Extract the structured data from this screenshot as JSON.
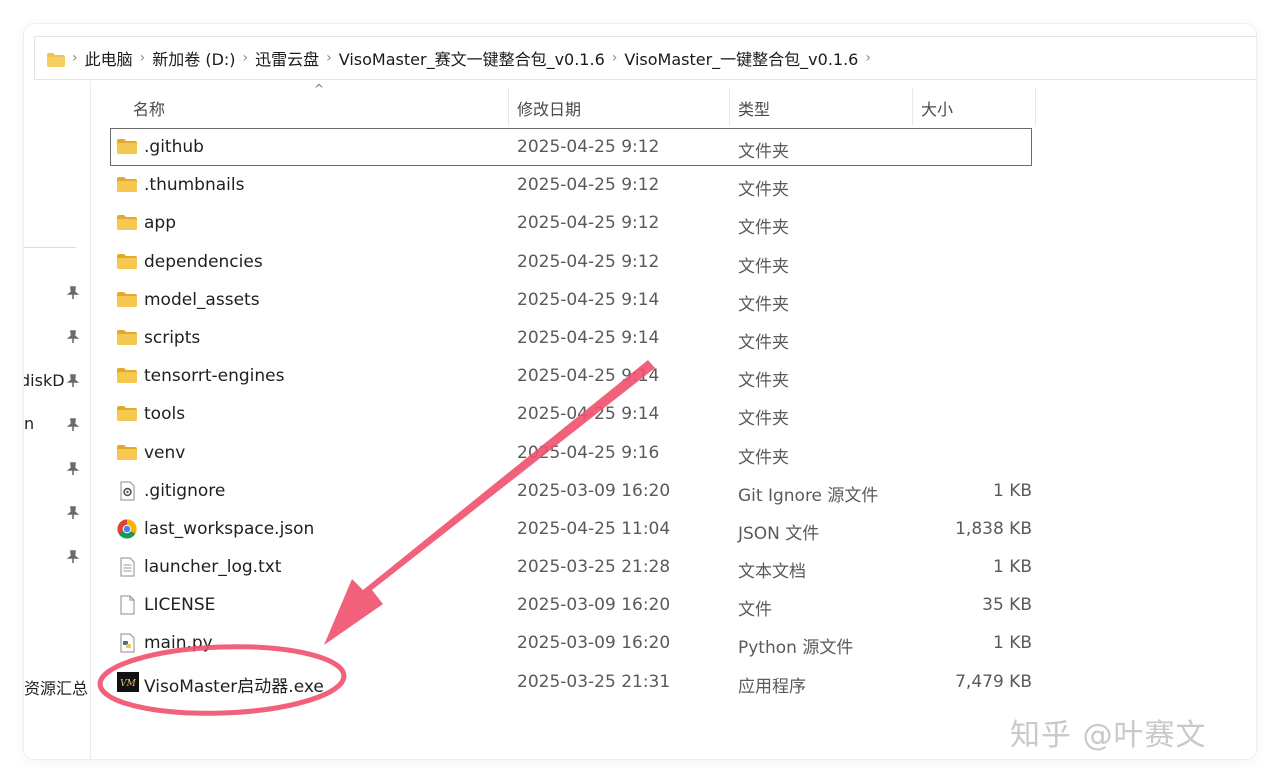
{
  "address": {
    "crumbs": [
      "此电脑",
      "新加卷 (D:)",
      "迅雷云盘",
      "VisoMaster_赛文一键整合包_v0.1.6",
      "VisoMaster_一键整合包_v0.1.6"
    ]
  },
  "nav": {
    "items": [
      {
        "label": "diskD"
      },
      {
        "label": "n"
      },
      {
        "label": "资源汇总"
      }
    ]
  },
  "columns": {
    "name": "名称",
    "date": "修改日期",
    "type": "类型",
    "size": "大小"
  },
  "files": [
    {
      "name": ".github",
      "date": "2025-04-25 9:12",
      "type": "文件夹",
      "size": "",
      "icon": "folder-icon"
    },
    {
      "name": ".thumbnails",
      "date": "2025-04-25 9:12",
      "type": "文件夹",
      "size": "",
      "icon": "folder-icon"
    },
    {
      "name": "app",
      "date": "2025-04-25 9:12",
      "type": "文件夹",
      "size": "",
      "icon": "folder-icon"
    },
    {
      "name": "dependencies",
      "date": "2025-04-25 9:12",
      "type": "文件夹",
      "size": "",
      "icon": "folder-icon"
    },
    {
      "name": "model_assets",
      "date": "2025-04-25 9:14",
      "type": "文件夹",
      "size": "",
      "icon": "folder-icon"
    },
    {
      "name": "scripts",
      "date": "2025-04-25 9:14",
      "type": "文件夹",
      "size": "",
      "icon": "folder-icon"
    },
    {
      "name": "tensorrt-engines",
      "date": "2025-04-25 9:14",
      "type": "文件夹",
      "size": "",
      "icon": "folder-icon"
    },
    {
      "name": "tools",
      "date": "2025-04-25 9:14",
      "type": "文件夹",
      "size": "",
      "icon": "folder-icon"
    },
    {
      "name": "venv",
      "date": "2025-04-25 9:16",
      "type": "文件夹",
      "size": "",
      "icon": "folder-icon"
    },
    {
      "name": ".gitignore",
      "date": "2025-03-09 16:20",
      "type": "Git Ignore 源文件",
      "size": "1 KB",
      "icon": "settings-file-icon"
    },
    {
      "name": "last_workspace.json",
      "date": "2025-04-25 11:04",
      "type": "JSON 文件",
      "size": "1,838 KB",
      "icon": "chrome-icon"
    },
    {
      "name": "launcher_log.txt",
      "date": "2025-03-25 21:28",
      "type": "文本文档",
      "size": "1 KB",
      "icon": "text-file-icon"
    },
    {
      "name": "LICENSE",
      "date": "2025-03-09 16:20",
      "type": "文件",
      "size": "35 KB",
      "icon": "blank-file-icon"
    },
    {
      "name": "main.py",
      "date": "2025-03-09 16:20",
      "type": "Python 源文件",
      "size": "1 KB",
      "icon": "python-file-icon"
    },
    {
      "name": "VisoMaster启动器.exe",
      "date": "2025-03-25 21:31",
      "type": "应用程序",
      "size": "7,479 KB",
      "icon": "visomaster-app-icon"
    }
  ],
  "exe_icon_text": "VM",
  "watermark": "知乎 @叶赛文",
  "colors": {
    "folder": "#f2c14e",
    "folder_dark": "#e3a92d",
    "annotation": "#f0506e"
  }
}
